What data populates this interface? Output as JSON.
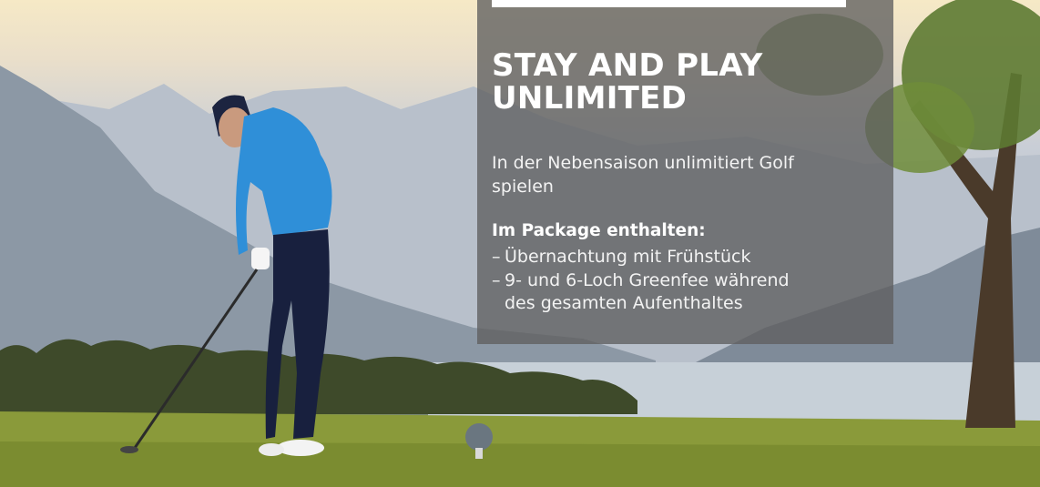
{
  "promo": {
    "headline_line1": "STAY AND PLAY",
    "headline_line2": "UNLIMITED",
    "subline": "In der Nebensaison unlimitiert Golf spielen",
    "package_title": "Im Package enthalten:",
    "package_items": [
      "Übernachtung mit Frühstück",
      "9- und 6-Loch Greenfee während des gesamten Aufenthaltes"
    ]
  },
  "image": {
    "icon": "golfer-teeing-off-photo"
  }
}
